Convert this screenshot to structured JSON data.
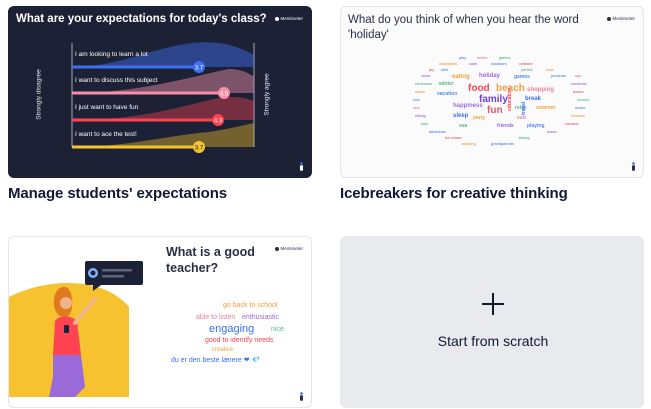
{
  "brand": "Mentimeter",
  "templates": [
    {
      "caption": "Manage students' expectations",
      "slide_title": "What are your expectations for today's class?",
      "axis_left": "Strongly disagree",
      "axis_right": "Strongly agree",
      "statements": [
        {
          "label": "I am looking to learn a lot",
          "value": "3.7",
          "color": "#3d6ff5"
        },
        {
          "label": "I want to discuss this subject",
          "value": "4.5",
          "color": "#f590a8"
        },
        {
          "label": "I just want to have fun",
          "value": "4.3",
          "color": "#ff4352"
        },
        {
          "label": "I want to ace the test!",
          "value": "3.7",
          "color": "#f7c42b"
        }
      ]
    },
    {
      "caption": "Icebreakers for creative thinking",
      "slide_title": "What do you think of when you hear the word 'holiday'",
      "big_words": [
        "food",
        "beach",
        "family",
        "fun",
        "shopping",
        "break",
        "happiness",
        "sleep",
        "party",
        "education",
        "travel",
        "relax",
        "sun",
        "sea",
        "friends",
        "playing",
        "eating",
        "games",
        "holiday",
        "winter",
        "vacation",
        "summer"
      ]
    },
    {
      "caption": "",
      "slide_title": "What is a good teacher?",
      "words": [
        "go back to school",
        "able to listen",
        "enthusiastic",
        "engaging",
        "nice",
        "good to identify needs",
        "creative",
        "du er den beste lærere ❤ 💎"
      ]
    },
    {
      "caption": "",
      "action_label": "Start from scratch"
    }
  ],
  "colors": {
    "dark_slide": "#1d2135",
    "scratch_bg": "#e8eaee",
    "caption_text": "#101834"
  }
}
